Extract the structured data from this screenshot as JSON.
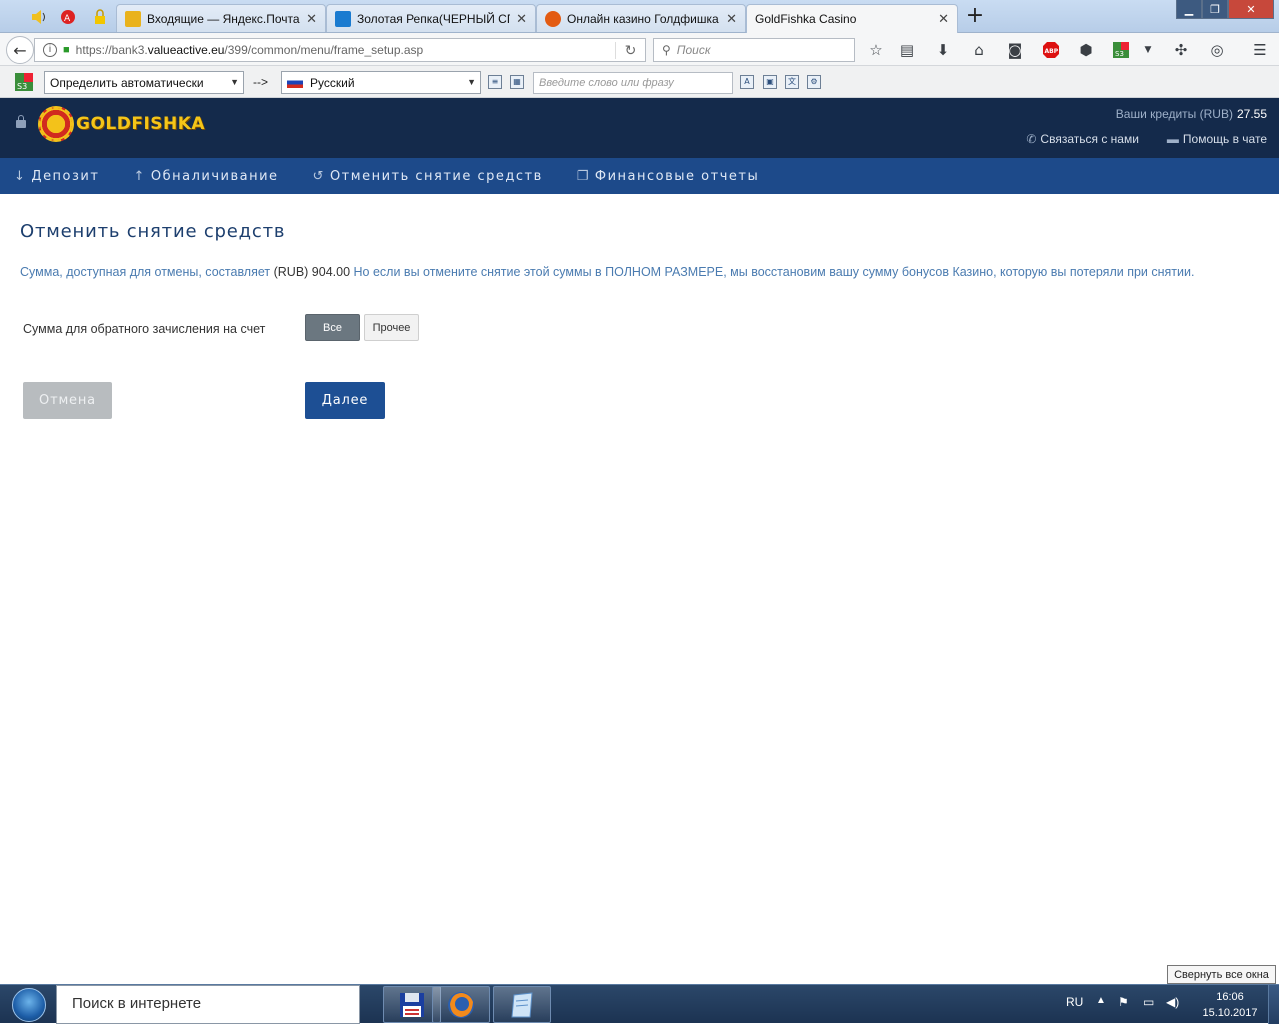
{
  "browser": {
    "tabs": [
      {
        "title": "Входящие — Яндекс.Почта",
        "favicon_color": "#e9b21c"
      },
      {
        "title": "Золотая Репка(ЧЕРНЫЙ СП",
        "favicon_color": "#1a7bd0"
      },
      {
        "title": "Онлайн казино Голдфишка",
        "favicon_color": "#e35b12"
      },
      {
        "title": "GoldFishka Casino",
        "favicon_color": ""
      }
    ],
    "url_prefix": "https://bank3.",
    "url_domain": "valueactive.eu",
    "url_path": "/399/common/menu/frame_setup.asp",
    "search_placeholder": "Поиск",
    "icons": [
      "back-icon",
      "info-icon",
      "lock-icon",
      "reload-icon",
      "search-icon",
      "bookmark-star-icon",
      "reading-list-icon",
      "download-icon",
      "home-icon",
      "pocket-icon",
      "adblock-icon",
      "extension-icon",
      "s3-icon",
      "menu-icon"
    ]
  },
  "translator": {
    "source_lang": "Определить автоматически",
    "arrow": "-->",
    "target_lang": "Русский",
    "input_placeholder": "Введите слово или фразу"
  },
  "casino": {
    "logo": "GOLDFISHKA",
    "credits_label": "Ваши кредиты (RUB)",
    "credits_value": "27.55",
    "contact_label": "Связаться с нами",
    "chat_label": "Помощь в чате",
    "nav": [
      {
        "label": "Депозит",
        "icon": "arrow-down-icon"
      },
      {
        "label": "Обналичивание",
        "icon": "arrow-up-icon"
      },
      {
        "label": "Отменить снятие средств",
        "icon": "undo-icon"
      },
      {
        "label": "Финансовые отчеты",
        "icon": "document-icon"
      }
    ]
  },
  "page": {
    "title": "Отменить снятие средств",
    "info_prefix": "Сумма, доступная для отмены, составляет",
    "info_amount": "(RUB) 904.00",
    "info_suffix": "Но если вы отмените снятие этой суммы в ПОЛНОМ РАЗМЕРЕ, мы восстановим вашу сумму бонусов Казино, которую вы потеряли при снятии.",
    "amount_label": "Сумма для обратного зачисления на счет",
    "btn_all": "Все",
    "btn_other": "Прочее",
    "btn_cancel": "Отмена",
    "btn_next": "Далее"
  },
  "taskbar": {
    "tooltip": "Свернуть все окна",
    "search_placeholder": "Поиск в интернете",
    "lang": "RU",
    "time": "16:06",
    "date": "15.10.2017"
  }
}
